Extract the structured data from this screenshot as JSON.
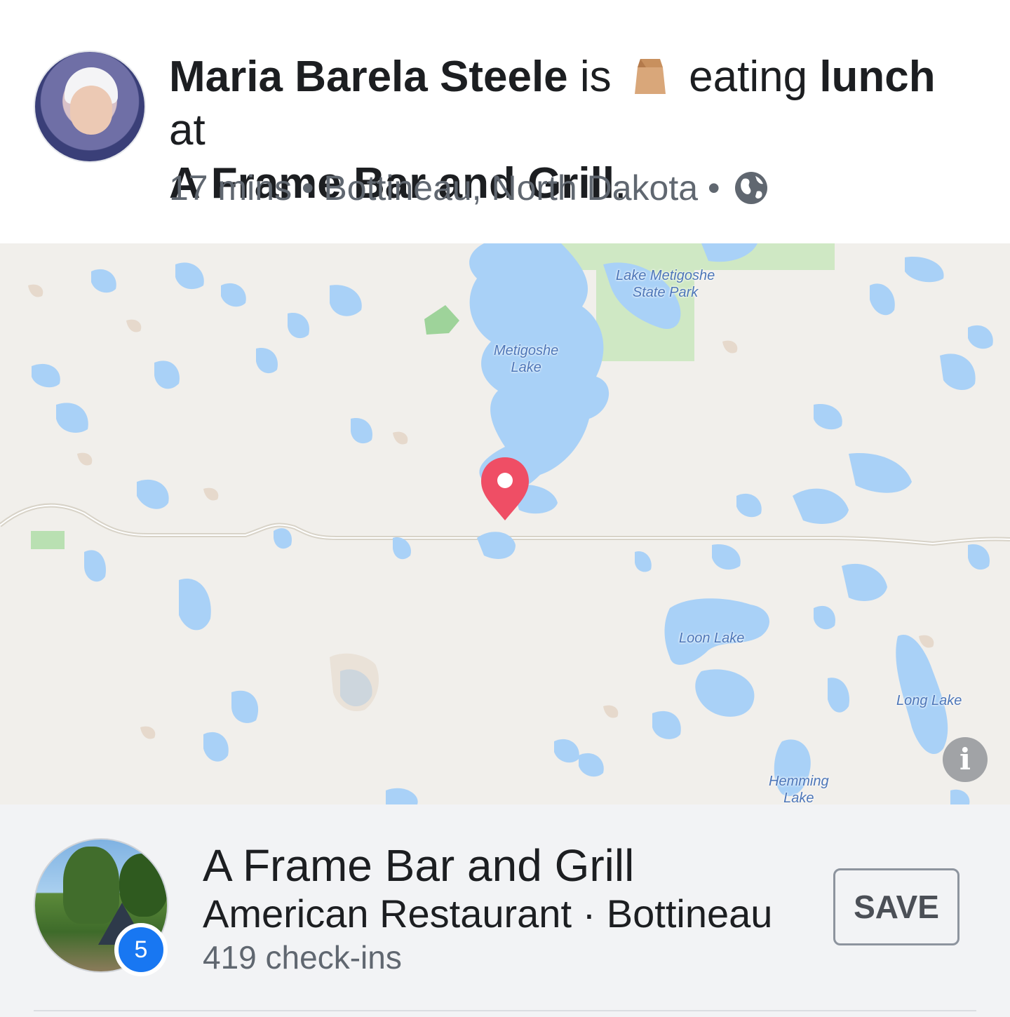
{
  "post": {
    "author": "Maria Barela Steele",
    "verb_is": "is",
    "activity_icon": "brown-paper-bag-icon",
    "activity_text": "eating",
    "activity_object": "lunch",
    "preposition": "at",
    "place_name": "A Frame Bar and Grill",
    "period": ".",
    "time": "17 mins",
    "separator": "•",
    "location": "Bottineau, North Dakota",
    "privacy_icon": "globe-icon"
  },
  "map": {
    "labels": {
      "park": "Lake Metigoshe\nState Park",
      "metigoshe": "Metigoshe\nLake",
      "loon": "Loon Lake",
      "long": "Long Lake",
      "hemming": "Hemming\nLake"
    },
    "pin_color": "#ef4e65",
    "water_color": "#a9d1f7",
    "park_color": "#cfe8c4",
    "info_label": "i"
  },
  "place_card": {
    "title": "A Frame Bar and Grill",
    "subtitle": "American Restaurant · Bottineau",
    "checkins": "419 check-ins",
    "badge_count": "5",
    "save_label": "SAVE",
    "accent": "#1877f2"
  }
}
